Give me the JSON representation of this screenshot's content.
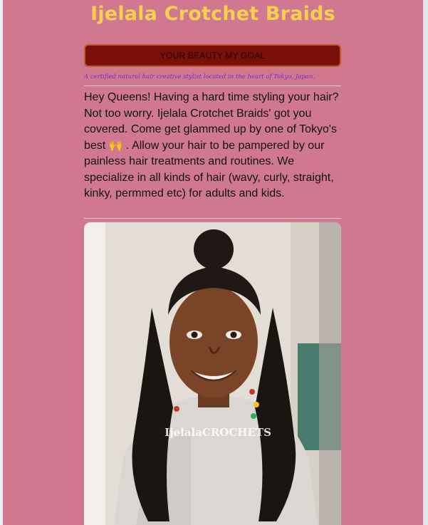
{
  "header": {
    "title": "Ijelala Crotchet Braids",
    "tagline": "YOUR BEAUTY MY GOAL",
    "subtitle": "A certified natural hair creative stylist located in the heart of Tokyo, Japan."
  },
  "intro": {
    "text": "Hey Queens! Having a hard time styling your hair? Not too worry. Ijelala Crotchet Braids' got you covered. Come get glammed up by one of Tokyo's best 🙌 . Allow your hair to be pampered by our painless hair treatments and routines. We specialize in all kinds of hair (wavy, curly, straight, kinky, permmed etc) for adults and kids."
  },
  "photo": {
    "watermark": "IjelalaCROCHETS"
  },
  "colors": {
    "background": "#d07890",
    "title": "#f6d04d",
    "tagline_bg": "#7a0f0c",
    "subtitle": "#6a2fc8"
  }
}
